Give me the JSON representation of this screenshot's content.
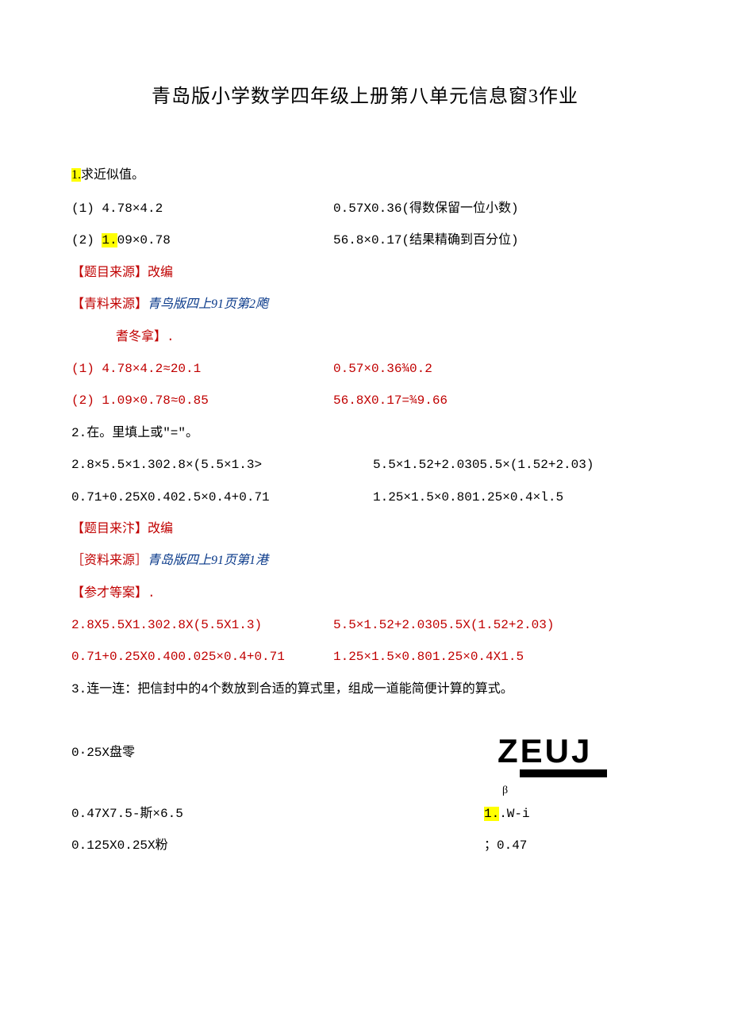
{
  "title": "青岛版小学数学四年级上册第八单元信息窗3作业",
  "q1": {
    "head_num": "1.",
    "head_text": "求近似值。",
    "line1_lead": "(1)   4.78×4.2",
    "line1_right": "0.57X0.36(得数保留一位小数)",
    "line2_lead": "(2)   ",
    "line2_hl": "1.",
    "line2_after": "09×0.78",
    "line2_right": "56.8×0.17(结果精确到百分位)",
    "src1": "【题目来源】改编",
    "src2_red": "【青料来源】",
    "src2_blue": "青鸟版四上91页第2飑",
    "src3": "耆冬拿】.",
    "ans1_a": "(1)  4.78×4.2≈20.1",
    "ans1_b": "0.57×0.36¾0.2",
    "ans2_a": "(2)  1.09×0.78≈0.85",
    "ans2_b": "56.8X0.17=¾9.66"
  },
  "q2": {
    "head": "2.在。里填上或\"=\"。",
    "line1_a": "2.8×5.5×1.302.8×(5.5×1.3>",
    "line1_b": "5.5×1.52+2.0305.5×(1.52+2.03)",
    "line2_a": "0.71+0.25X0.402.5×0.4+0.71",
    "line2_b": "1.25×1.5×0.801.25×0.4×l.5",
    "src1": "【题目来汴】改编",
    "src2_red": "［资料来源］",
    "src2_blue": "青岛版四上91页第1港",
    "src3": "【参才等案】.",
    "ans1_a": "2.8X5.5X1.302.8X(5.5X1.3)",
    "ans1_b": "5.5×1.52+2.0305.5X(1.52+2.03)",
    "ans2_a": "0.71+0.25X0.400.025×0.4+0.71",
    "ans2_b": "1.25×1.5×0.801.25×0.4X1.5"
  },
  "q3": {
    "head": "3.连一连：把信封中的4个数放到合适的算式里，组成一道能简便计算的算式。",
    "zeuj": "ZEUJ",
    "beta": "β",
    "line1_l": "0·25X盘零",
    "line2_l": "0.47X7.5-斯×6.5",
    "line2_r_hl": "1.",
    "line2_r_after": ".W-i",
    "line3_l": "0.125X0.25X粉",
    "line3_r": "；0.47"
  }
}
